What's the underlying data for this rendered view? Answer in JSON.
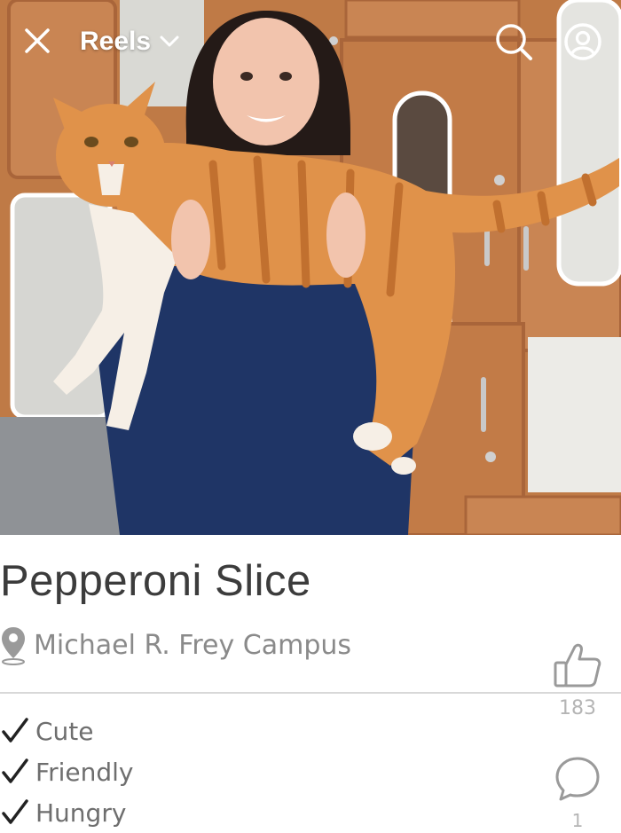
{
  "header": {
    "title": "Reels",
    "close_icon": "close-icon",
    "dropdown_icon": "chevron-down-icon",
    "search_icon": "search-icon",
    "profile_icon": "user-circle-icon"
  },
  "photo": {
    "subject": "person holding orange tabby cat"
  },
  "pet": {
    "name": "Pepperoni Slice",
    "location": "Michael R. Frey Campus",
    "location_icon": "location-pin-icon"
  },
  "traits": [
    {
      "label": "Cute"
    },
    {
      "label": "Friendly"
    },
    {
      "label": "Hungry"
    }
  ],
  "actions": {
    "likes": "183",
    "like_icon": "thumbs-up-icon",
    "comments": "1",
    "comment_icon": "comment-bubble-icon"
  },
  "colors": {
    "overlay_icon": "#ffffff",
    "title_text": "#3c3c3c",
    "secondary_text": "#8a8a8a",
    "count_text": "#b5b5b5"
  }
}
